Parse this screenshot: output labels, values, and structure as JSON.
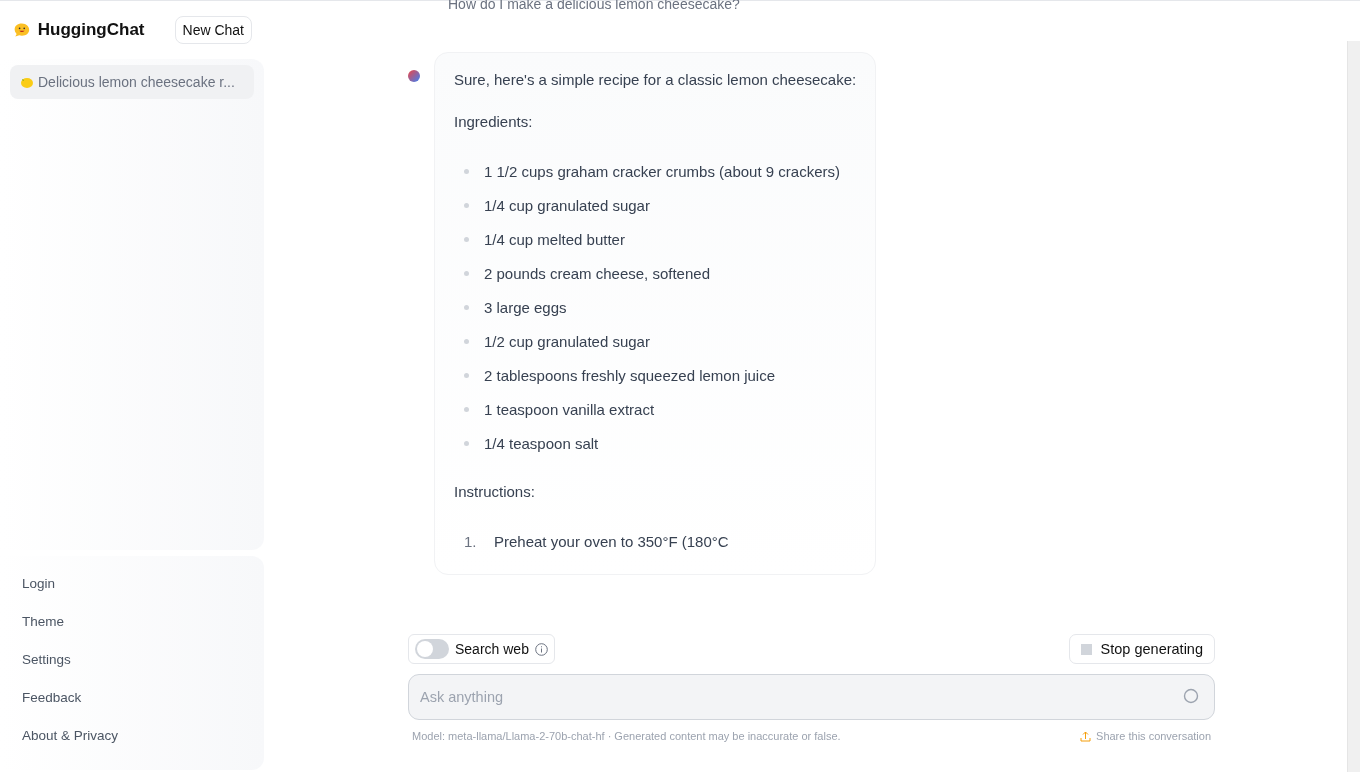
{
  "sidebar": {
    "brand": "HuggingChat",
    "new_chat_button": "New Chat",
    "conversations": [
      {
        "title": "Delicious lemon cheesecake r...",
        "selected": true
      }
    ],
    "menu": [
      "Login",
      "Theme",
      "Settings",
      "Feedback",
      "About & Privacy"
    ]
  },
  "chat": {
    "question": "How do I make a delicious lemon cheesecake?",
    "answer": {
      "intro": "Sure, here's a simple recipe for a classic lemon cheesecake:",
      "ingredients_heading": "Ingredients:",
      "ingredients": [
        "1 1/2 cups graham cracker crumbs (about 9 crackers)",
        "1/4 cup granulated sugar",
        "1/4 cup melted butter",
        "2 pounds cream cheese, softened",
        "3 large eggs",
        "1/2 cup granulated sugar",
        "2 tablespoons freshly squeezed lemon juice",
        "1 teaspoon vanilla extract",
        "1/4 teaspoon salt"
      ],
      "instructions_heading": "Instructions:",
      "instructions": [
        {
          "number": "1.",
          "text": "Preheat your oven to 350°F (180°C"
        }
      ]
    }
  },
  "controls": {
    "search_web": {
      "label": "Search web",
      "on": false
    },
    "stop_button": "Stop generating"
  },
  "input": {
    "placeholder": "Ask anything"
  },
  "footer": {
    "model_note": "Model: meta-llama/Llama-2-70b-chat-hf · Generated content may be inaccurate or false.",
    "share_link": "Share this conversation"
  }
}
